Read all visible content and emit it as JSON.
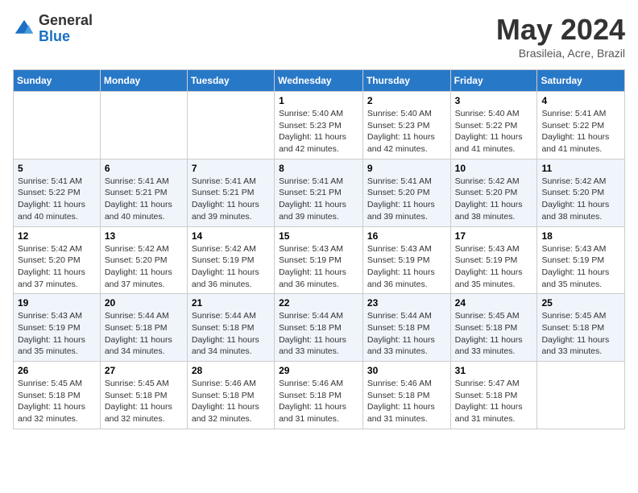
{
  "header": {
    "logo": {
      "general": "General",
      "blue": "Blue"
    },
    "title": "May 2024",
    "subtitle": "Brasileia, Acre, Brazil"
  },
  "days_of_week": [
    "Sunday",
    "Monday",
    "Tuesday",
    "Wednesday",
    "Thursday",
    "Friday",
    "Saturday"
  ],
  "weeks": [
    [
      {
        "day": "",
        "info": ""
      },
      {
        "day": "",
        "info": ""
      },
      {
        "day": "",
        "info": ""
      },
      {
        "day": "1",
        "info": "Sunrise: 5:40 AM\nSunset: 5:23 PM\nDaylight: 11 hours and 42 minutes."
      },
      {
        "day": "2",
        "info": "Sunrise: 5:40 AM\nSunset: 5:23 PM\nDaylight: 11 hours and 42 minutes."
      },
      {
        "day": "3",
        "info": "Sunrise: 5:40 AM\nSunset: 5:22 PM\nDaylight: 11 hours and 41 minutes."
      },
      {
        "day": "4",
        "info": "Sunrise: 5:41 AM\nSunset: 5:22 PM\nDaylight: 11 hours and 41 minutes."
      }
    ],
    [
      {
        "day": "5",
        "info": "Sunrise: 5:41 AM\nSunset: 5:22 PM\nDaylight: 11 hours and 40 minutes."
      },
      {
        "day": "6",
        "info": "Sunrise: 5:41 AM\nSunset: 5:21 PM\nDaylight: 11 hours and 40 minutes."
      },
      {
        "day": "7",
        "info": "Sunrise: 5:41 AM\nSunset: 5:21 PM\nDaylight: 11 hours and 39 minutes."
      },
      {
        "day": "8",
        "info": "Sunrise: 5:41 AM\nSunset: 5:21 PM\nDaylight: 11 hours and 39 minutes."
      },
      {
        "day": "9",
        "info": "Sunrise: 5:41 AM\nSunset: 5:20 PM\nDaylight: 11 hours and 39 minutes."
      },
      {
        "day": "10",
        "info": "Sunrise: 5:42 AM\nSunset: 5:20 PM\nDaylight: 11 hours and 38 minutes."
      },
      {
        "day": "11",
        "info": "Sunrise: 5:42 AM\nSunset: 5:20 PM\nDaylight: 11 hours and 38 minutes."
      }
    ],
    [
      {
        "day": "12",
        "info": "Sunrise: 5:42 AM\nSunset: 5:20 PM\nDaylight: 11 hours and 37 minutes."
      },
      {
        "day": "13",
        "info": "Sunrise: 5:42 AM\nSunset: 5:20 PM\nDaylight: 11 hours and 37 minutes."
      },
      {
        "day": "14",
        "info": "Sunrise: 5:42 AM\nSunset: 5:19 PM\nDaylight: 11 hours and 36 minutes."
      },
      {
        "day": "15",
        "info": "Sunrise: 5:43 AM\nSunset: 5:19 PM\nDaylight: 11 hours and 36 minutes."
      },
      {
        "day": "16",
        "info": "Sunrise: 5:43 AM\nSunset: 5:19 PM\nDaylight: 11 hours and 36 minutes."
      },
      {
        "day": "17",
        "info": "Sunrise: 5:43 AM\nSunset: 5:19 PM\nDaylight: 11 hours and 35 minutes."
      },
      {
        "day": "18",
        "info": "Sunrise: 5:43 AM\nSunset: 5:19 PM\nDaylight: 11 hours and 35 minutes."
      }
    ],
    [
      {
        "day": "19",
        "info": "Sunrise: 5:43 AM\nSunset: 5:19 PM\nDaylight: 11 hours and 35 minutes."
      },
      {
        "day": "20",
        "info": "Sunrise: 5:44 AM\nSunset: 5:18 PM\nDaylight: 11 hours and 34 minutes."
      },
      {
        "day": "21",
        "info": "Sunrise: 5:44 AM\nSunset: 5:18 PM\nDaylight: 11 hours and 34 minutes."
      },
      {
        "day": "22",
        "info": "Sunrise: 5:44 AM\nSunset: 5:18 PM\nDaylight: 11 hours and 33 minutes."
      },
      {
        "day": "23",
        "info": "Sunrise: 5:44 AM\nSunset: 5:18 PM\nDaylight: 11 hours and 33 minutes."
      },
      {
        "day": "24",
        "info": "Sunrise: 5:45 AM\nSunset: 5:18 PM\nDaylight: 11 hours and 33 minutes."
      },
      {
        "day": "25",
        "info": "Sunrise: 5:45 AM\nSunset: 5:18 PM\nDaylight: 11 hours and 33 minutes."
      }
    ],
    [
      {
        "day": "26",
        "info": "Sunrise: 5:45 AM\nSunset: 5:18 PM\nDaylight: 11 hours and 32 minutes."
      },
      {
        "day": "27",
        "info": "Sunrise: 5:45 AM\nSunset: 5:18 PM\nDaylight: 11 hours and 32 minutes."
      },
      {
        "day": "28",
        "info": "Sunrise: 5:46 AM\nSunset: 5:18 PM\nDaylight: 11 hours and 32 minutes."
      },
      {
        "day": "29",
        "info": "Sunrise: 5:46 AM\nSunset: 5:18 PM\nDaylight: 11 hours and 31 minutes."
      },
      {
        "day": "30",
        "info": "Sunrise: 5:46 AM\nSunset: 5:18 PM\nDaylight: 11 hours and 31 minutes."
      },
      {
        "day": "31",
        "info": "Sunrise: 5:47 AM\nSunset: 5:18 PM\nDaylight: 11 hours and 31 minutes."
      },
      {
        "day": "",
        "info": ""
      }
    ]
  ]
}
